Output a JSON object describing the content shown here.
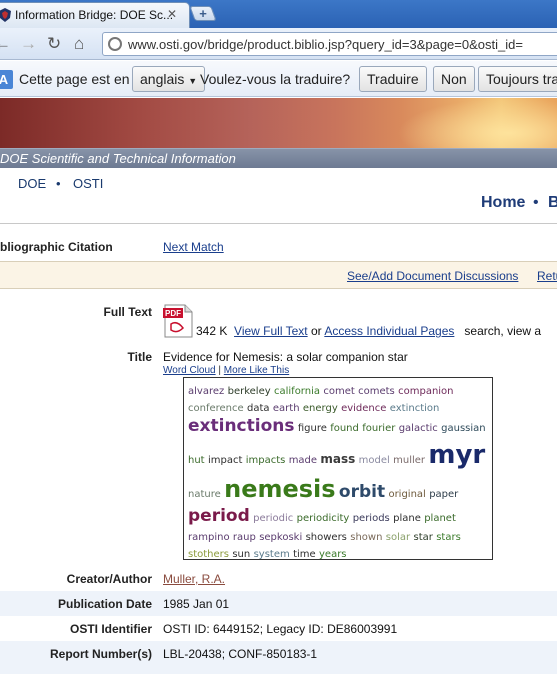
{
  "browser": {
    "tab_title": "Information Bridge: DOE Sc...",
    "tab_close": "✕",
    "new_tab": "+",
    "url": "www.osti.gov/bridge/product.biblio.jsp?query_id=3&page=0&osti_id=",
    "nav_back": "←",
    "nav_forward": "→",
    "nav_reload": "↻",
    "nav_home": "⌂"
  },
  "translate_bar": {
    "icon_letter": "A",
    "prompt": "Cette page est en",
    "language": "anglais",
    "question": "Voulez-vous la traduire?",
    "translate_button": "Traduire",
    "no_button": "Non",
    "always_button": "Toujours tra"
  },
  "banner": {
    "agency": "DOE Scientific and Technical Information"
  },
  "top_nav": {
    "doe": "DOE",
    "osti": "OSTI",
    "separator": "•"
  },
  "site_nav": {
    "home": "Home",
    "next": "B",
    "separator": "•"
  },
  "citation": {
    "section_label": "bliographic Citation",
    "next_match": "Next Match"
  },
  "discuss_bar": {
    "discussions_link": "See/Add Document Discussions",
    "return_link": "Retu"
  },
  "record": {
    "full_text_label": "Full Text",
    "pdf_label": "PDF",
    "file_size": "342 K",
    "view_full_text": "View Full Text",
    "or_text": "or",
    "access_pages": "Access Individual Pages",
    "search_text": "search, view a",
    "title_label": "Title",
    "title_value": "Evidence for Nemesis: a solar companion star",
    "word_cloud_link": "Word Cloud",
    "link_separator": "|",
    "more_like_this": "More Like This",
    "creator_label": "Creator/Author",
    "creator_value": "Muller, R.A.",
    "pub_date_label": "Publication Date",
    "pub_date_value": "1985 Jan 01",
    "osti_id_label": "OSTI Identifier",
    "osti_id_value": "OSTI ID: 6449152; Legacy ID: DE86003991",
    "report_label": "Report Number(s)",
    "report_value": "LBL-20438; CONF-850183-1"
  },
  "word_cloud": {
    "lines": [
      [
        {
          "word": "alvarez",
          "size": 10,
          "color": "#5a3c6e"
        },
        {
          "word": "berkeley",
          "size": 10,
          "color": "#2e3d2a"
        },
        {
          "word": "california",
          "size": 10,
          "color": "#3a7a2a"
        },
        {
          "word": "comet",
          "size": 10,
          "color": "#5a3c6e"
        },
        {
          "word": "comets",
          "size": 10,
          "color": "#5a3c6e"
        },
        {
          "word": "companion",
          "size": 10,
          "color": "#6e2a5a"
        }
      ],
      [
        {
          "word": "conference",
          "size": 10,
          "color": "#6a7a6a"
        },
        {
          "word": "data",
          "size": 10,
          "color": "#2e2e2e"
        },
        {
          "word": "earth",
          "size": 10,
          "color": "#5a3c6e"
        },
        {
          "word": "energy",
          "size": 10,
          "color": "#3a5a2a"
        },
        {
          "word": "evidence",
          "size": 10,
          "color": "#6e2a5a"
        },
        {
          "word": "extinction",
          "size": 10,
          "color": "#5a7a8a"
        }
      ],
      [
        {
          "word": "extinctions",
          "size": 17,
          "color": "#6a2e7a",
          "bold": true
        },
        {
          "word": "figure",
          "size": 10,
          "color": "#2e2e2e"
        },
        {
          "word": "found",
          "size": 10,
          "color": "#3a6a2a"
        },
        {
          "word": "fourier",
          "size": 10,
          "color": "#3a6a2a"
        },
        {
          "word": "galactic",
          "size": 10,
          "color": "#5a3c6e"
        },
        {
          "word": "gaussian",
          "size": 10,
          "color": "#2e4a5a"
        }
      ],
      [
        {
          "word": "hut",
          "size": 10,
          "color": "#3a6a2a"
        },
        {
          "word": "impact",
          "size": 10,
          "color": "#2e2e2e"
        },
        {
          "word": "impacts",
          "size": 10,
          "color": "#3a6a2a"
        },
        {
          "word": "made",
          "size": 10,
          "color": "#5a3c6e"
        },
        {
          "word": "mass",
          "size": 12,
          "color": "#3a3a3a",
          "bold": true
        },
        {
          "word": "model",
          "size": 10,
          "color": "#8a8aa0"
        },
        {
          "word": "muller",
          "size": 10,
          "color": "#7a6a6a"
        },
        {
          "word": "myr",
          "size": 26,
          "color": "#1a2a6a",
          "bold": true
        }
      ],
      [
        {
          "word": "nature",
          "size": 10,
          "color": "#6a7a6a"
        },
        {
          "word": "nemesis",
          "size": 24,
          "color": "#3a7a1a",
          "bold": true
        },
        {
          "word": "orbit",
          "size": 17,
          "color": "#2e4a6a",
          "bold": true
        },
        {
          "word": "original",
          "size": 10,
          "color": "#6e5a3c"
        },
        {
          "word": "paper",
          "size": 10,
          "color": "#2e3d4a"
        }
      ],
      [
        {
          "word": "period",
          "size": 17,
          "color": "#7a1a4a",
          "bold": true
        },
        {
          "word": "periodic",
          "size": 10,
          "color": "#8a7a9a"
        },
        {
          "word": "periodicity",
          "size": 10,
          "color": "#3a6a2a"
        },
        {
          "word": "periods",
          "size": 10,
          "color": "#3a3a5a"
        },
        {
          "word": "plane",
          "size": 10,
          "color": "#2e2e2e"
        },
        {
          "word": "planet",
          "size": 10,
          "color": "#3a6a2a"
        }
      ],
      [
        {
          "word": "rampino",
          "size": 10,
          "color": "#5a3c6e"
        },
        {
          "word": "raup",
          "size": 10,
          "color": "#5a3c6e"
        },
        {
          "word": "sepkoski",
          "size": 10,
          "color": "#5a3c6e"
        },
        {
          "word": "showers",
          "size": 10,
          "color": "#2e2e2e"
        },
        {
          "word": "shown",
          "size": 10,
          "color": "#7a6a5a"
        },
        {
          "word": "solar",
          "size": 10,
          "color": "#8aa06a"
        },
        {
          "word": "star",
          "size": 10,
          "color": "#2e3d2a"
        },
        {
          "word": "stars",
          "size": 10,
          "color": "#3a7a2a"
        }
      ],
      [
        {
          "word": "stothers",
          "size": 10,
          "color": "#8a9a3a"
        },
        {
          "word": "sun",
          "size": 10,
          "color": "#2e2e2e"
        },
        {
          "word": "system",
          "size": 10,
          "color": "#5a7a8a"
        },
        {
          "word": "time",
          "size": 10,
          "color": "#2e2e2e"
        },
        {
          "word": "years",
          "size": 10,
          "color": "#3a7a2a"
        }
      ]
    ]
  }
}
